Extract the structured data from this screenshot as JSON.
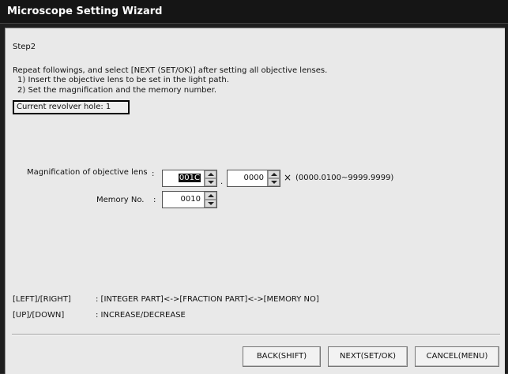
{
  "window": {
    "title": "Microscope Setting Wizard"
  },
  "step": {
    "label": "Step2"
  },
  "instructions": {
    "line1": "Repeat followings, and select [NEXT (SET/OK)] after setting all objective lenses.",
    "line2": "1) Insert the objective lens to be set in the light path.",
    "line3": "2) Set the magnification and the memory number."
  },
  "current_hole": {
    "text": "Current revolver hole: 1"
  },
  "magnification": {
    "label": "Magnification of objective lens",
    "colon": ":",
    "integer_value": "001C",
    "separator": ".",
    "fraction_value": "0000",
    "times_symbol": "×",
    "range": "(0000.0100∼9999.9999)"
  },
  "memory": {
    "label": "Memory No.",
    "colon": ":",
    "value": "0010"
  },
  "help": {
    "row1_key": "[LEFT]/[RIGHT]",
    "row1_desc": ": [INTEGER PART]<->[FRACTION PART]<->[MEMORY NO]",
    "row2_key": "[UP]/[DOWN]",
    "row2_desc": ": INCREASE/DECREASE"
  },
  "buttons": {
    "back": "BACK(SHIFT)",
    "next": "NEXT(SET/OK)",
    "cancel": "CANCEL(MENU)"
  }
}
